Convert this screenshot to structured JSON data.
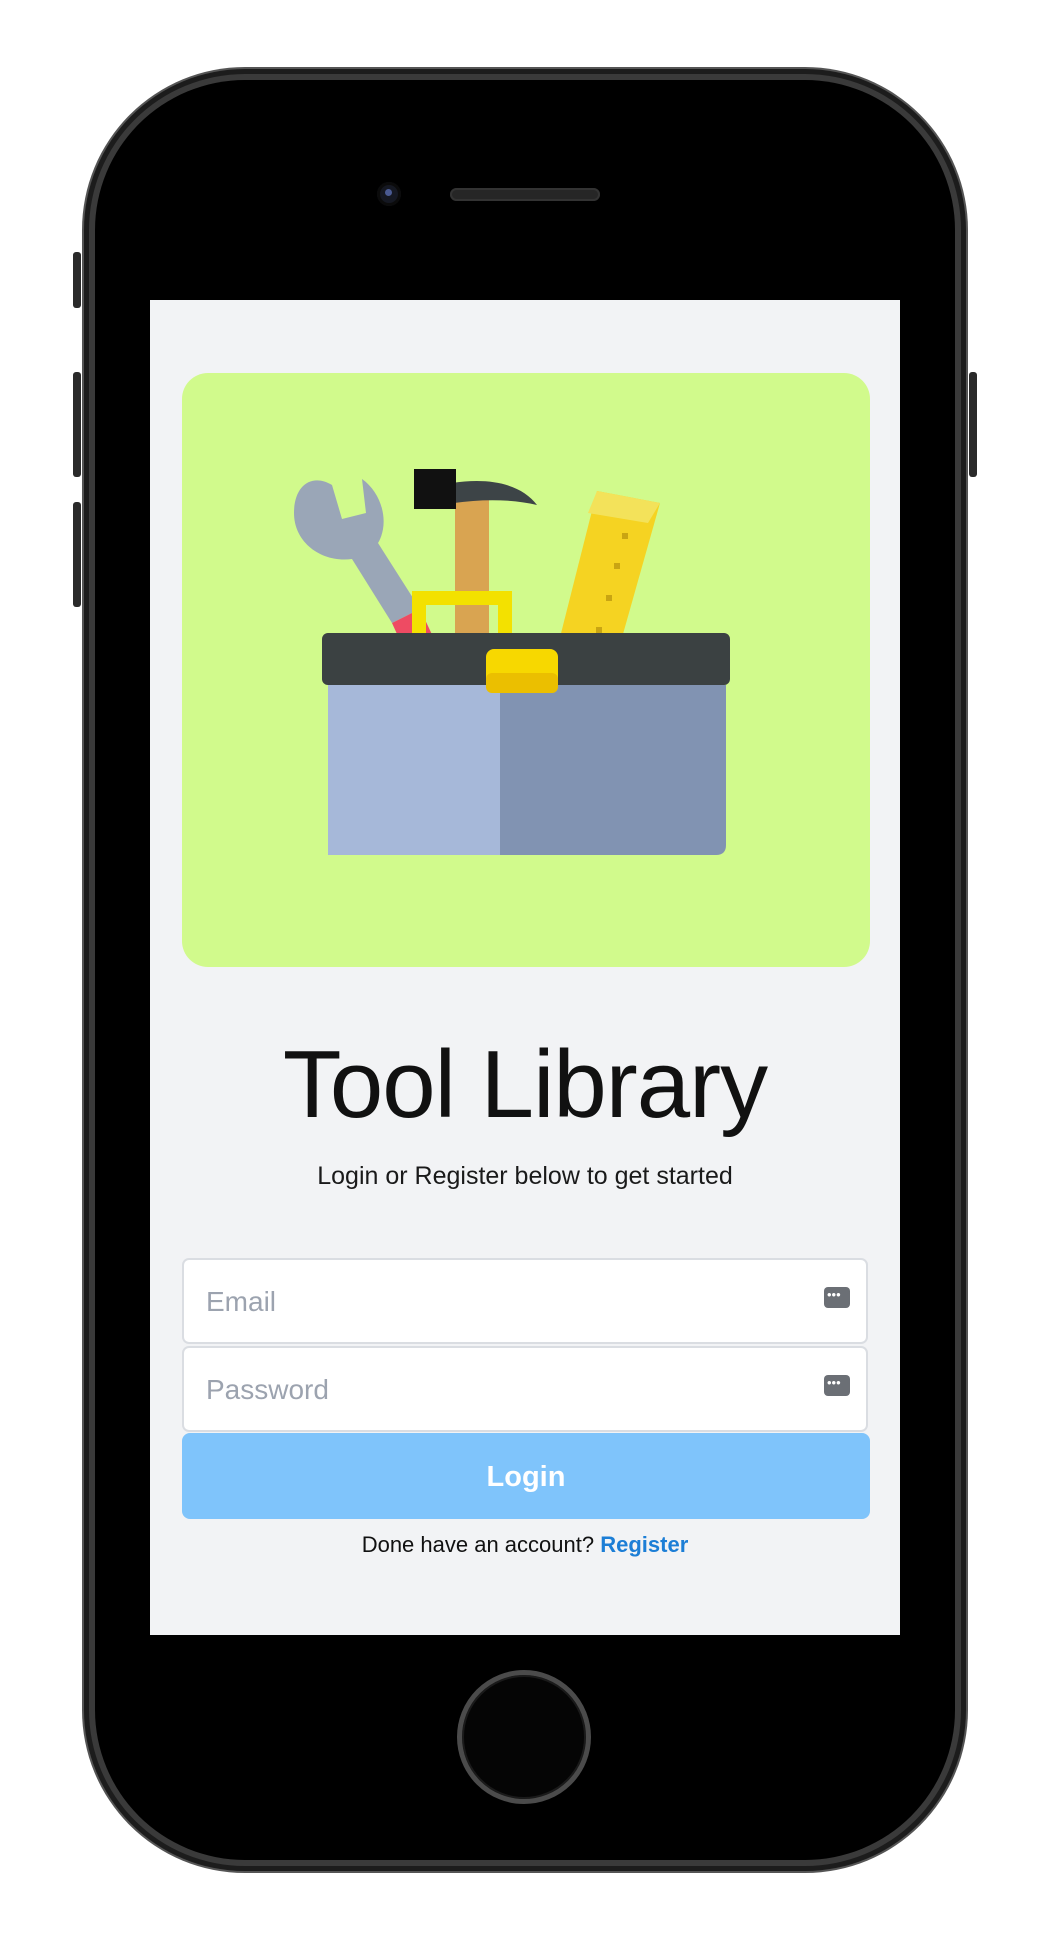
{
  "app": {
    "title": "Tool Library",
    "subtitle": "Login or Register below to get started"
  },
  "hero": {
    "image_name": "toolbox-illustration",
    "background_color": "#d1fa8c"
  },
  "form": {
    "email_placeholder": "Email",
    "email_value": "",
    "password_placeholder": "Password",
    "password_value": "",
    "login_label": "Login",
    "login_button_color": "#7fc4fb",
    "register_prompt": "Done have an account?",
    "register_link": "Register",
    "register_link_color": "#1c7ed6"
  },
  "icons": {
    "field_icon": "password-manager-key-icon"
  }
}
